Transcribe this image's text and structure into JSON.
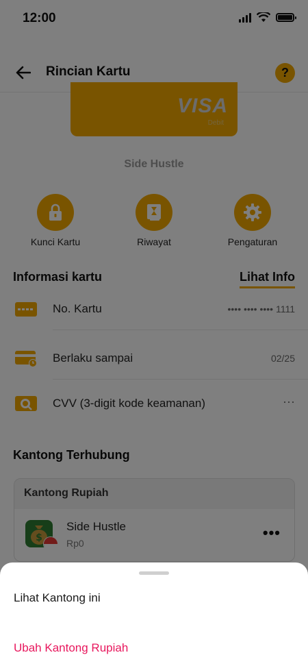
{
  "status_bar": {
    "time": "12:00"
  },
  "header": {
    "title": "Rincian Kartu",
    "back_icon": "arrow-left-icon",
    "help_label": "?"
  },
  "card": {
    "brand": "VISA",
    "type": "Debit",
    "name": "Side Hustle",
    "color": "#f2a900"
  },
  "actions": [
    {
      "label": "Kunci Kartu",
      "icon": "lock-icon"
    },
    {
      "label": "Riwayat",
      "icon": "hourglass-icon"
    },
    {
      "label": "Pengaturan",
      "icon": "gear-icon"
    }
  ],
  "info": {
    "title": "Informasi kartu",
    "link": "Lihat Info",
    "rows": [
      {
        "label": "No. Kartu",
        "value": "•••• •••• •••• 1111",
        "icon": "card-icon"
      },
      {
        "label": "Berlaku sampai",
        "value": "02/25",
        "icon": "card-clock-icon"
      },
      {
        "label": "CVV (3-digit kode keamanan)",
        "value": "···",
        "icon": "card-search-icon"
      }
    ]
  },
  "kantong": {
    "title": "Kantong Terhubung",
    "box_title": "Kantong Rupiah",
    "item": {
      "name": "Side Hustle",
      "balance": "Rp0",
      "more": "•••",
      "icon": "money-bag-icon",
      "flag": "indonesia-flag-icon"
    }
  },
  "sheet": {
    "options": [
      {
        "label": "Lihat Kantong ini",
        "color": "#1a1a1a"
      },
      {
        "label": "Ubah Kantong Rupiah",
        "color": "#e8175d"
      }
    ]
  }
}
